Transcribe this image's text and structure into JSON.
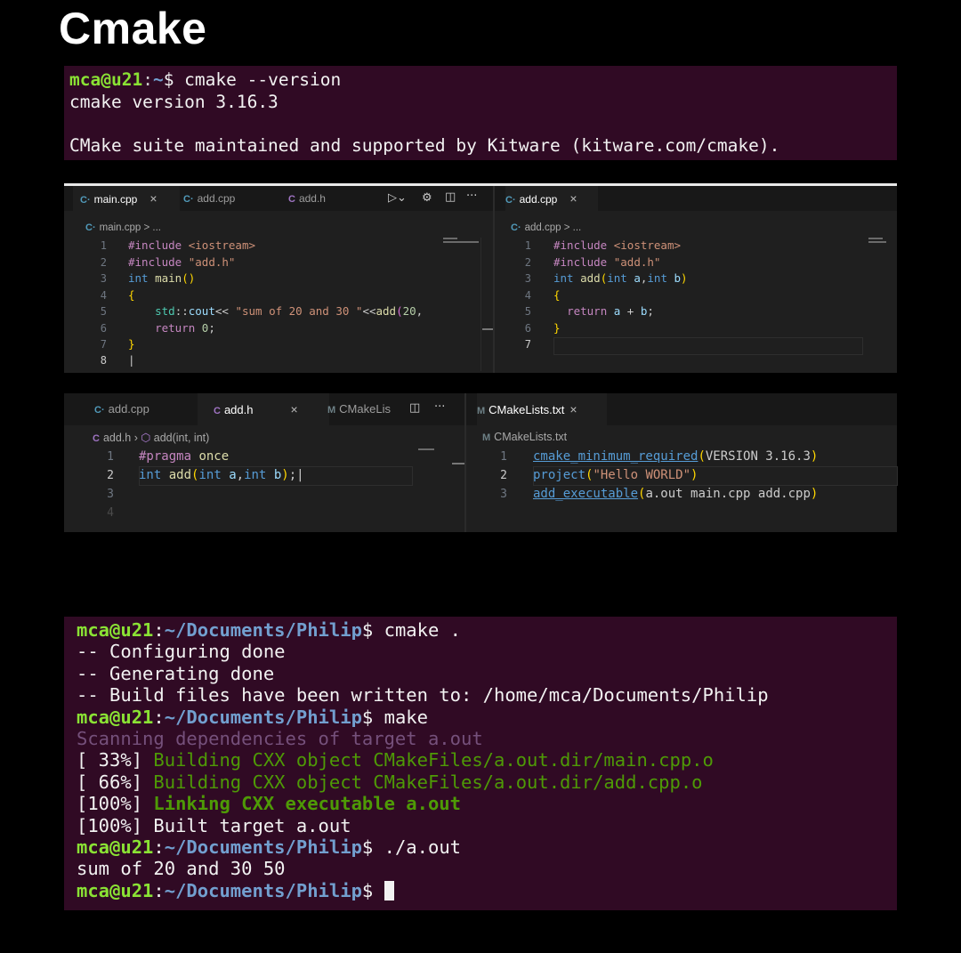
{
  "title": "Cmake",
  "terminal_version": {
    "prompt_user": "mca@u21",
    "prompt_path": "~",
    "command": "cmake --version",
    "lines": [
      "cmake version 3.16.3",
      "",
      "CMake suite maintained and supported by Kitware (kitware.com/cmake)."
    ]
  },
  "editor_main": {
    "left_group": {
      "tabs": [
        {
          "icon": "cpp-file-icon",
          "label": "main.cpp",
          "active": true
        },
        {
          "icon": "cpp-file-icon",
          "label": "add.cpp",
          "active": false
        },
        {
          "icon": "c-header-file-icon",
          "label": "add.h",
          "active": false
        }
      ],
      "breadcrumb": "main.cpp > ...",
      "line_numbers": [
        "1",
        "2",
        "3",
        "4",
        "5",
        "6",
        "7",
        "8"
      ],
      "code": [
        "#include <iostream>",
        "#include \"add.h\"",
        "int main()",
        "{",
        "    std::cout<< \"sum of 20 and 30 \"<<add(20,",
        "    return 0;",
        "}",
        "|"
      ]
    },
    "right_group": {
      "tabs": [
        {
          "icon": "cpp-file-icon",
          "label": "add.cpp",
          "active": true
        }
      ],
      "breadcrumb": "add.cpp > ...",
      "line_numbers": [
        "1",
        "2",
        "3",
        "4",
        "5",
        "6",
        "7"
      ],
      "code": [
        "#include <iostream>",
        "#include \"add.h\"",
        "int add(int a,int b)",
        "{",
        "    return a + b;",
        "}",
        ""
      ]
    }
  },
  "editor_header": {
    "left_group": {
      "tabs": [
        {
          "icon": "cpp-file-icon",
          "label": "add.cpp",
          "active": false
        },
        {
          "icon": "c-header-file-icon",
          "label": "add.h",
          "active": true
        },
        {
          "icon": "cmake-file-icon",
          "label": "CMakeLis",
          "active": false
        }
      ],
      "breadcrumb_file": "add.h",
      "breadcrumb_symbol": "add(int, int)",
      "line_numbers": [
        "1",
        "2",
        "3",
        "4"
      ],
      "code": [
        "#pragma once",
        "int add(int a,int b);"
      ]
    },
    "right_group": {
      "tabs": [
        {
          "icon": "cmake-file-icon",
          "label": "CMakeLists.txt",
          "active": true
        }
      ],
      "breadcrumb": "CMakeLists.txt",
      "line_numbers": [
        "1",
        "2",
        "3"
      ],
      "code": [
        "cmake_minimum_required(VERSION 3.16.3)",
        "project(\"Hello WORLD\")",
        "add_executable(a.out main.cpp add.cpp)"
      ]
    }
  },
  "terminal_build": {
    "prompt_user": "mca@u21",
    "prompt_path": "~/Documents/Philip",
    "lines": [
      {
        "type": "prompt",
        "command": " cmake ."
      },
      {
        "type": "out",
        "text": "-- Configuring done"
      },
      {
        "type": "out",
        "text": "-- Generating done"
      },
      {
        "type": "out",
        "text": "-- Build files have been written to: /home/mca/Documents/Philip"
      },
      {
        "type": "prompt",
        "command": " make"
      },
      {
        "type": "scan",
        "text": "Scanning dependencies of target a.out"
      },
      {
        "type": "build",
        "pct": "[ 33%] ",
        "text": "Building CXX object CMakeFiles/a.out.dir/main.cpp.o"
      },
      {
        "type": "build",
        "pct": "[ 66%] ",
        "text": "Building CXX object CMakeFiles/a.out.dir/add.cpp.o"
      },
      {
        "type": "link",
        "pct": "[100%] ",
        "text": "Linking CXX executable a.out"
      },
      {
        "type": "out",
        "text": "[100%] Built target a.out"
      },
      {
        "type": "prompt",
        "command": " ./a.out"
      },
      {
        "type": "out",
        "text": "sum of 20 and 30 50"
      },
      {
        "type": "prompt",
        "command": " "
      }
    ]
  }
}
